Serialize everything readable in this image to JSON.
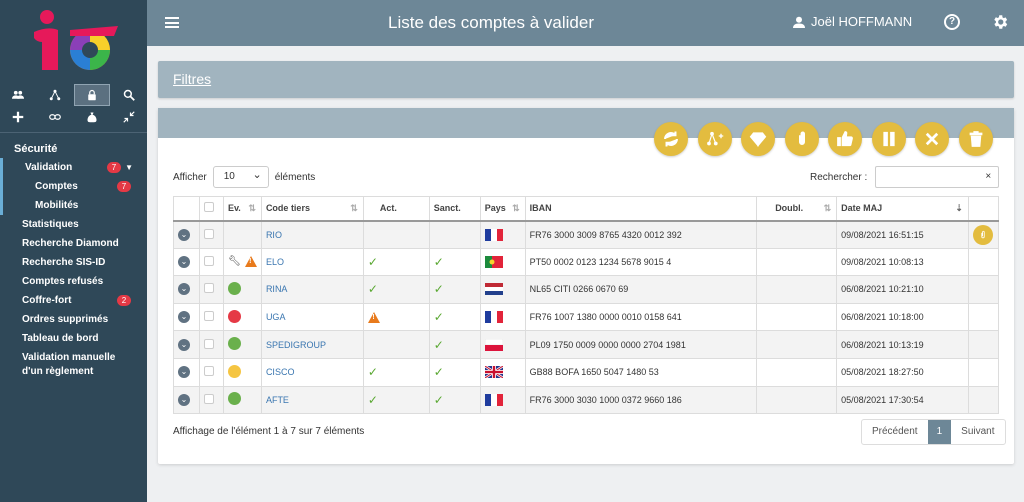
{
  "header": {
    "title": "Liste des comptes à valider",
    "user": "Joël HOFFMANN"
  },
  "sidebar": {
    "section": "Sécurité",
    "items": [
      {
        "label": "Validation",
        "badge": "7",
        "child": false,
        "group": true
      },
      {
        "label": "Comptes",
        "badge": "7",
        "child": true,
        "group": true
      },
      {
        "label": "Mobilités",
        "badge": "",
        "child": true,
        "group": true
      },
      {
        "label": "Statistiques",
        "badge": "",
        "child": false,
        "group": false
      },
      {
        "label": "Recherche Diamond",
        "badge": "",
        "child": false,
        "group": false
      },
      {
        "label": "Recherche SIS-ID",
        "badge": "",
        "child": false,
        "group": false
      },
      {
        "label": "Comptes refusés",
        "badge": "",
        "child": false,
        "group": false
      },
      {
        "label": "Coffre-fort",
        "badge": "2",
        "child": false,
        "group": false
      },
      {
        "label": "Ordres supprimés",
        "badge": "",
        "child": false,
        "group": false
      },
      {
        "label": "Tableau de bord",
        "badge": "",
        "child": false,
        "group": false
      },
      {
        "label": "Validation manuelle d'un règlement",
        "badge": "",
        "child": false,
        "group": false
      }
    ]
  },
  "filters": {
    "label": "Filtres"
  },
  "table_controls": {
    "show_label": "Afficher",
    "page_length": "10",
    "elements_label": "éléments",
    "search_label": "Rechercher :",
    "search_value": "",
    "clear_icon": "×"
  },
  "columns": [
    "Ev.",
    "Code tiers",
    "Act.",
    "Sanct.",
    "Pays",
    "IBAN",
    "Doubl.",
    "Date MAJ"
  ],
  "rows": [
    {
      "ev": "none",
      "code": "RIO",
      "act": "",
      "sanct": "",
      "country": "FR",
      "iban": "FR76 3000 3009 8765 4320 0012 392",
      "doubl": "",
      "date": "09/08/2021 16:51:15",
      "attach": true
    },
    {
      "ev": "warn",
      "code": "ELO",
      "act": "check",
      "sanct": "check",
      "country": "PT",
      "iban": "PT50 0002 0123 1234 5678 9015 4",
      "doubl": "",
      "date": "09/08/2021 10:08:13",
      "attach": false
    },
    {
      "ev": "green",
      "code": "RINA",
      "act": "check",
      "sanct": "check",
      "country": "NL",
      "iban": "NL65 CITI 0266 0670 69",
      "doubl": "",
      "date": "06/08/2021 10:21:10",
      "attach": false
    },
    {
      "ev": "red",
      "code": "UGA",
      "act": "warn",
      "sanct": "check",
      "country": "FR",
      "iban": "FR76 1007 1380 0000 0010 0158 641",
      "doubl": "",
      "date": "06/08/2021 10:18:00",
      "attach": false
    },
    {
      "ev": "green",
      "code": "SPEDIGROUP",
      "act": "",
      "sanct": "check",
      "country": "PL",
      "iban": "PL09 1750 0009 0000 0000 2704 1981",
      "doubl": "",
      "date": "06/08/2021 10:13:19",
      "attach": false
    },
    {
      "ev": "yellow",
      "code": "CISCO",
      "act": "check",
      "sanct": "check",
      "country": "GB",
      "iban": "GB88 BOFA 1650 5047 1480 53",
      "doubl": "",
      "date": "05/08/2021 18:27:50",
      "attach": false
    },
    {
      "ev": "green",
      "code": "AFTE",
      "act": "check",
      "sanct": "check",
      "country": "FR",
      "iban": "FR76 3000 3030 1000 0372 9660 186",
      "doubl": "",
      "date": "05/08/2021 17:30:54",
      "attach": false
    }
  ],
  "info": "Affichage de l'élément 1 à 7 sur 7 éléments",
  "pager": {
    "prev": "Précédent",
    "current": "1",
    "next": "Suivant"
  },
  "colors": {
    "accent": "#e3bc3f",
    "sidebar": "#2f4858",
    "header": "#6d8797",
    "green": "#6ab04c",
    "red": "#e53945",
    "yellow": "#f5c542",
    "warn": "#e87a1c"
  }
}
